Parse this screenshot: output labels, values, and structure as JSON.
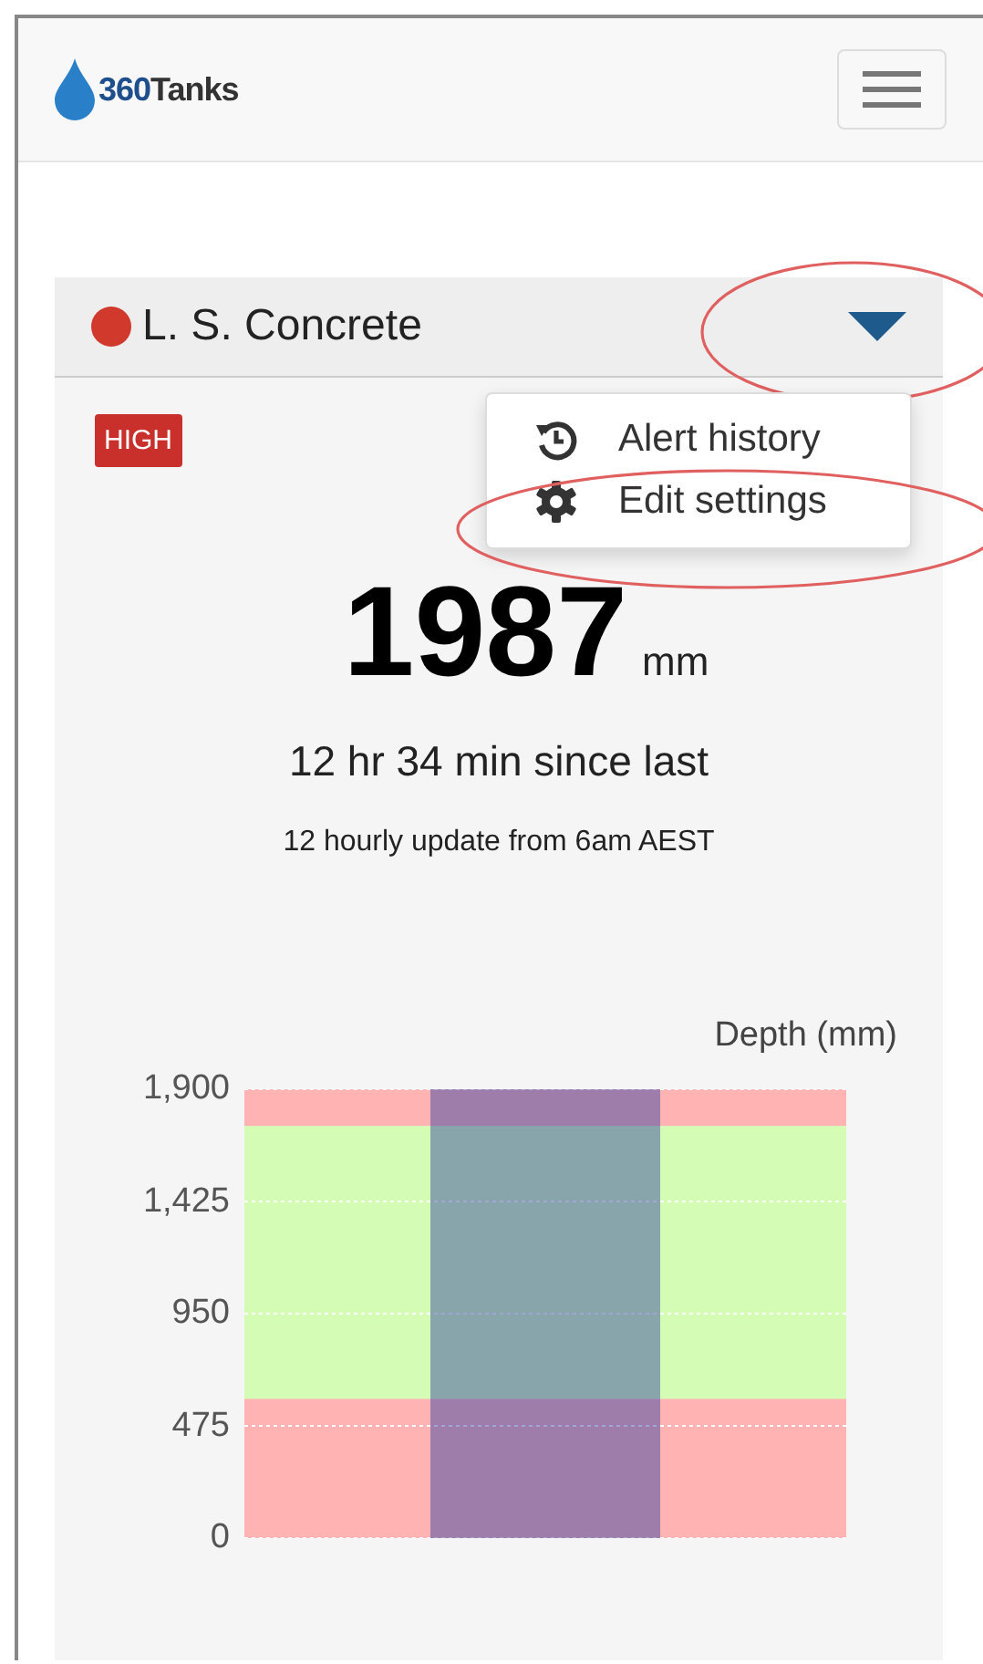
{
  "navbar": {
    "brand_number": "360",
    "brand_name": "Tanks"
  },
  "tank": {
    "name": "L. S. Concrete",
    "badge": "HIGH",
    "menu_open": true,
    "menu": [
      {
        "kind": "history",
        "label": "Alert history"
      },
      {
        "kind": "settings",
        "label": "Edit settings"
      }
    ],
    "reading": "1987",
    "unit": "mm",
    "since": "12 hr 34 min since last",
    "update_note": "12 hourly update from 6am AEST",
    "chart_data": {
      "type": "bar",
      "ylabel": "Depth (mm)",
      "values": [
        1900
      ],
      "ylim": [
        0,
        1900
      ],
      "grid": true,
      "yticks": [
        {
          "value": 0,
          "label": "0"
        },
        {
          "value": 475,
          "label": "475"
        },
        {
          "value": 950,
          "label": "950"
        },
        {
          "value": 1425,
          "label": "1,425"
        },
        {
          "value": 1900,
          "label": "1,900"
        }
      ],
      "bands": [
        {
          "axis": "y",
          "from": 0,
          "to": 590,
          "color": "#ffb3b3"
        },
        {
          "axis": "y",
          "from": 590,
          "to": 1745,
          "color": "#d4fcb4"
        },
        {
          "axis": "y",
          "from": 1745,
          "to": 1900,
          "color": "#ffb3b3"
        }
      ]
    }
  }
}
